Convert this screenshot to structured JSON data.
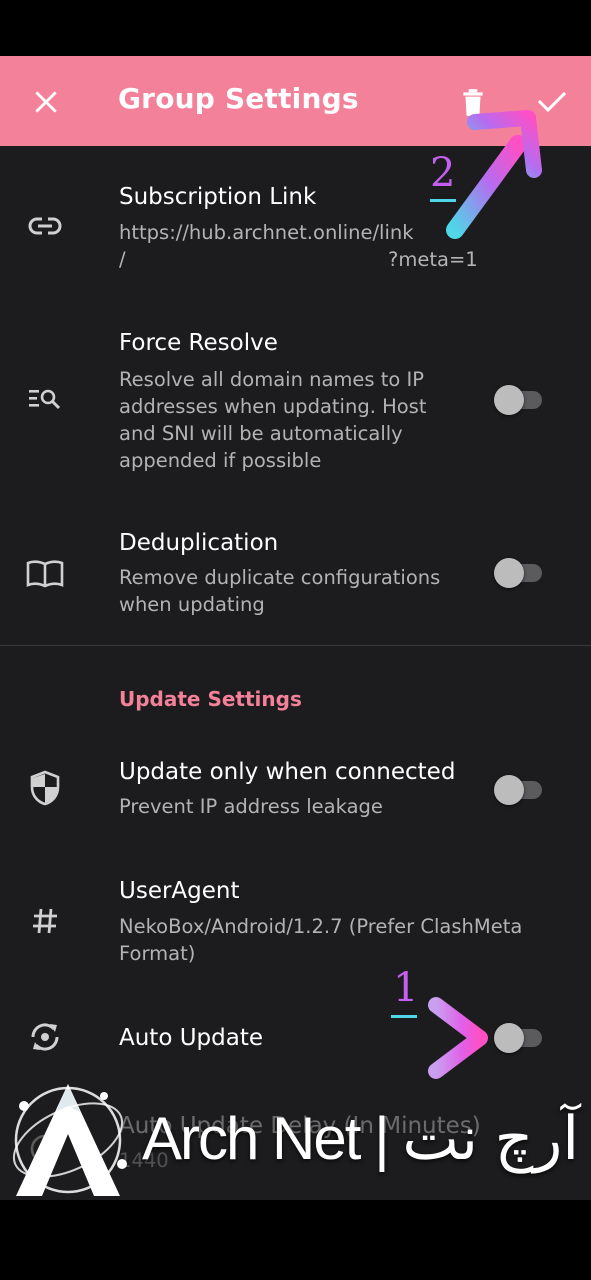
{
  "toolbar": {
    "title": "Group Settings",
    "close_icon": "close-icon",
    "delete_icon": "trash-icon",
    "save_icon": "check-icon",
    "background": "#f4819a"
  },
  "prefs": {
    "subscription": {
      "title": "Subscription Link",
      "summary_line1": "https://hub.archnet.online/link",
      "summary_line2_start": "/",
      "summary_line2_end": "?meta=1",
      "icon": "link-icon"
    },
    "force_resolve": {
      "title": "Force Resolve",
      "summary": "Resolve all domain names to IP addresses when updating. Host and SNI will be automatically appended if possible",
      "icon": "search-list-icon",
      "enabled": false
    },
    "deduplication": {
      "title": "Deduplication",
      "summary": "Remove duplicate configurations when updating",
      "icon": "book-icon",
      "enabled": false
    }
  },
  "update_section": {
    "header": "Update Settings",
    "header_color": "#f4819a",
    "update_when_connected": {
      "title": "Update only when connected",
      "summary": "Prevent IP address leakage",
      "icon": "shield-icon",
      "enabled": false
    },
    "user_agent": {
      "title": "UserAgent",
      "summary": "NekoBox/Android/1.2.7 (Prefer ClashMeta Format)",
      "icon": "hash-icon"
    },
    "auto_update": {
      "title": "Auto Update",
      "icon": "sync-icon",
      "enabled": false
    },
    "auto_update_delay": {
      "title": "Auto Update Delay (In Minutes)",
      "summary": "1440",
      "icon": "clock-icon"
    }
  },
  "annotations": {
    "step1": "1",
    "step2": "2"
  },
  "watermark": {
    "text": "Arch Net | آرچ نت",
    "logo": "arch-logo"
  }
}
